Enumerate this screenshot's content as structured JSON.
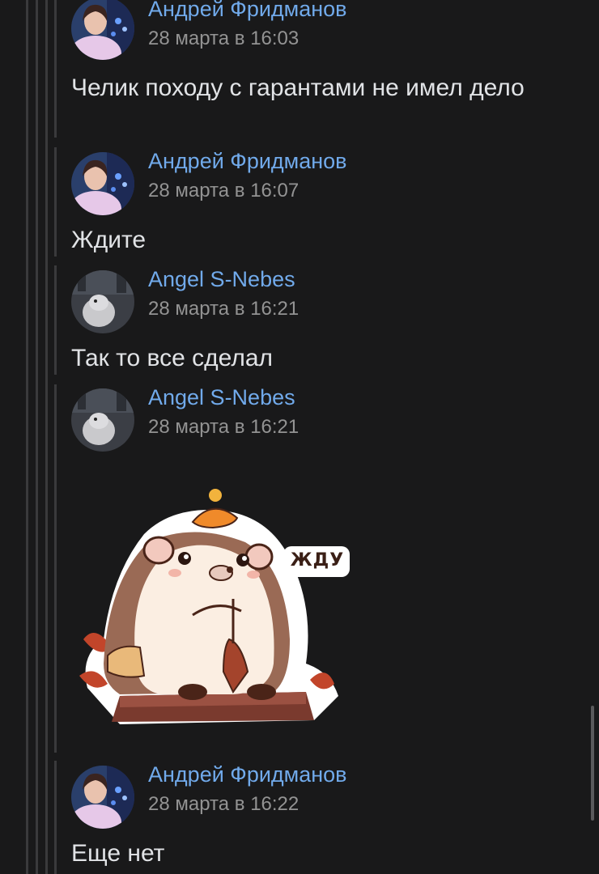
{
  "comments": [
    {
      "author": "Андрей Фридманов",
      "time": "28 марта в 16:03",
      "text": "Челик походу с гарантами не имел дело",
      "avatar": "user-avatar-andrey"
    },
    {
      "author": "Андрей Фридманов",
      "time": "28 марта в 16:07",
      "text": "Ждите",
      "avatar": "user-avatar-andrey"
    },
    {
      "author": "Angel S-Nebes",
      "time": "28 марта в 16:21",
      "text": "Так то все сделал",
      "avatar": "user-avatar-angel"
    },
    {
      "author": "Angel S-Nebes",
      "time": "28 марта в 16:21",
      "sticker": "hedgehog-waiting-sticker",
      "sticker_text": "ЖДУ",
      "avatar": "user-avatar-angel"
    },
    {
      "author": "Андрей Фридманов",
      "time": "28 марта в 16:22",
      "text": "Еще нет",
      "avatar": "user-avatar-andrey"
    }
  ],
  "colors": {
    "background": "#19191a",
    "author_link": "#71aaeb",
    "timestamp": "#939393",
    "text": "#e1e3e6",
    "thread_line": "#3a3a3c"
  }
}
